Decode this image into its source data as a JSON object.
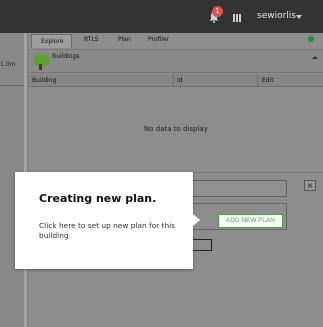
{
  "topbar": {
    "notification_count": "1",
    "username": "sewiorlis",
    "icons": [
      "bell-icon",
      "grid-icon",
      "caret-down-icon"
    ]
  },
  "left_panel": {
    "scale_label": "1.0m"
  },
  "tabs": [
    {
      "label": "Explore",
      "active": true
    },
    {
      "label": "RTLS",
      "active": false
    },
    {
      "label": "Plan",
      "active": false
    },
    {
      "label": "Profiler",
      "active": false
    }
  ],
  "section": {
    "title": "Buildings",
    "icon": "tree-icon"
  },
  "table": {
    "columns": [
      "Building",
      "Id",
      "Edit"
    ],
    "empty_message": "No data to display"
  },
  "tutorial": {
    "title": "Creating new plan.",
    "body": "Click here to set up new plan for this building",
    "button_label": "ADD NEW PLAN"
  },
  "colors": {
    "topbar": "#333333",
    "accent_green": "#3fae3f",
    "badge_red": "#d9534f",
    "overlay_gray": "#7e7e7e"
  }
}
